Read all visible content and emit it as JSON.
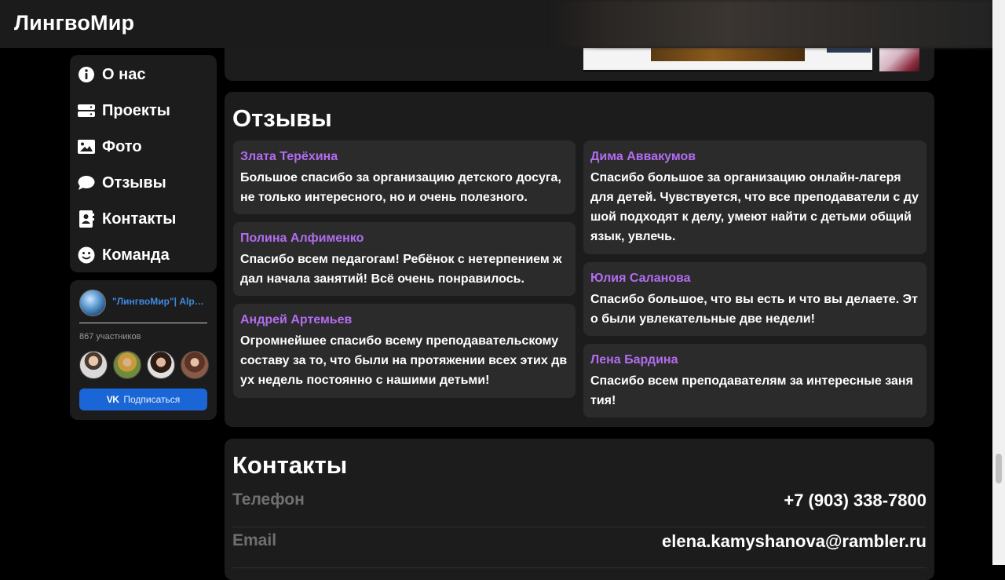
{
  "header": {
    "logo": "ЛингвоМир"
  },
  "sidebar": {
    "items": [
      {
        "icon": "info-icon",
        "label": "О нас"
      },
      {
        "icon": "server-icon",
        "label": "Проекты"
      },
      {
        "icon": "image-icon",
        "label": "Фото"
      },
      {
        "icon": "comment-icon",
        "label": "Отзывы"
      },
      {
        "icon": "address-book-icon",
        "label": "Контакты"
      },
      {
        "icon": "smile-icon",
        "label": "Команда"
      }
    ]
  },
  "vk_widget": {
    "group_name": "\"ЛингвоМир\"| Alpha...",
    "members_count": "867 участников",
    "subscribe_label": "Подписаться",
    "button_color": "#1a66d6"
  },
  "reviews": {
    "title": "Отзывы",
    "left": [
      {
        "author": "Злата Терёхина",
        "text": "Большое спасибо за организацию детского досуга, не только интересного, но и очень полезного."
      },
      {
        "author": "Полина Алфименко",
        "text": "Спасибо всем педагогам! Ребёнок с нетерпением ж дал начала занятий! Всё очень понравилось."
      },
      {
        "author": "Андрей Артемьев",
        "text": "Огромнейшее спасибо всему преподавательскому составу за то, что были на протяжении всех этих дв ух недель постоянно с нашими детьми!"
      }
    ],
    "right": [
      {
        "author": "Дима Аввакумов",
        "text": "Спасибо большое за организацию онлайн-лагеря для детей. Чувствуется, что все преподаватели с ду шой подходят к делу, умеют найти с детьми общий язык, увлечь."
      },
      {
        "author": "Юлия Саланова",
        "text": "Спасибо большое, что вы есть и что вы делаете. Эт о были увлекательные две недели!"
      },
      {
        "author": "Лена Бардина",
        "text": "Спасибо всем преподавателям за интересные заня тия!"
      }
    ],
    "author_color": "#b36cf0"
  },
  "contacts": {
    "title": "Контакты",
    "rows": [
      {
        "label": "Телефон",
        "value": "+7 (903) 338-7800"
      },
      {
        "label": "Email",
        "value": "elena.kamyshanova@rambler.ru"
      }
    ]
  }
}
